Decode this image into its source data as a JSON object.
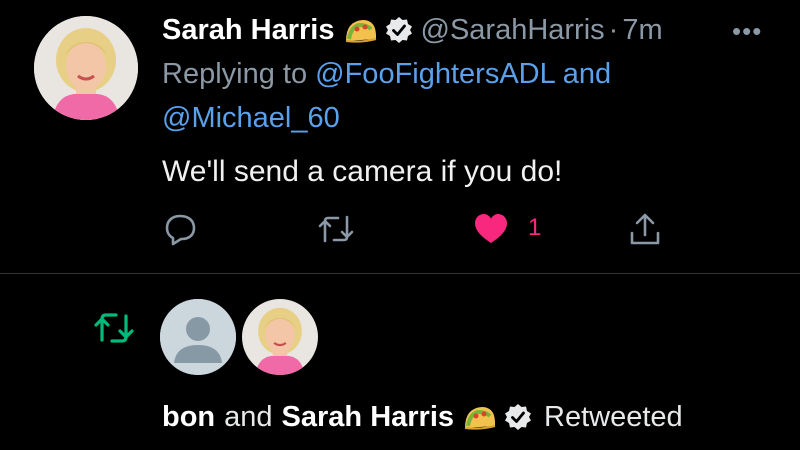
{
  "tweet": {
    "author_name": "Sarah Harris",
    "emoji_icon": "taco-icon",
    "verified_icon": "verified-badge-icon",
    "handle": "@SarahHarris",
    "separator": "·",
    "time": "7m",
    "more_label": "•••",
    "replying_prefix": "Replying to",
    "reply_to_1": "@FooFightersADL",
    "reply_joiner": "and",
    "reply_to_2": "@Michael_60",
    "text": "We'll send a camera if you do!",
    "actions": {
      "reply_icon": "comment-icon",
      "retweet_icon": "retweet-icon",
      "like_icon": "heart-filled-icon",
      "like_count": "1",
      "share_icon": "share-icon"
    }
  },
  "retweet_row": {
    "retweet_icon": "retweet-icon",
    "user1": "bon",
    "joiner": "and",
    "user2": "Sarah Harris",
    "action": "Retweeted"
  },
  "colors": {
    "background": "#000000",
    "link": "#5aa0ea",
    "muted": "#8b98a5",
    "like": "#f7287e",
    "retweet": "#00ba7c"
  }
}
